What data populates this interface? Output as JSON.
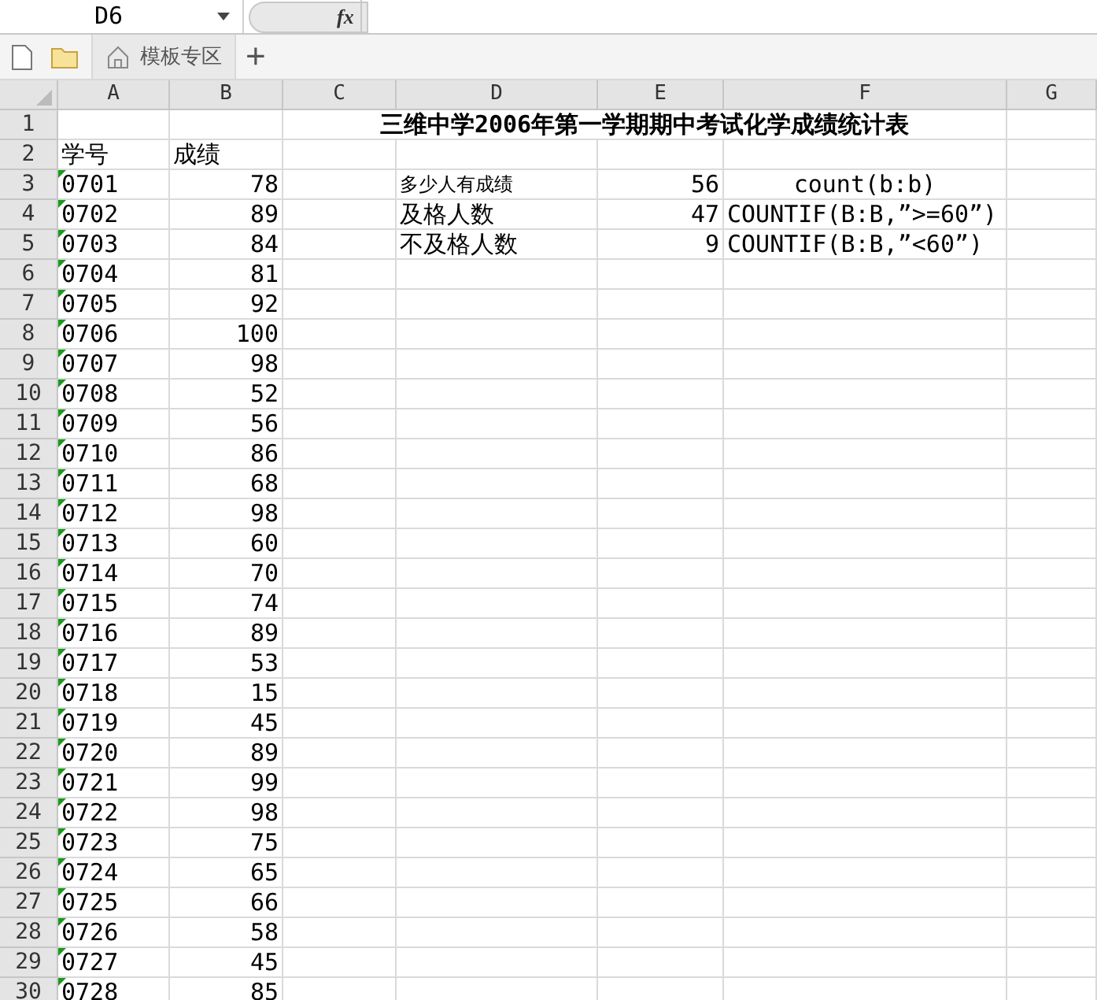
{
  "name_box": "D6",
  "formula_button": "fx",
  "new_tab": "+",
  "tabs": [
    {
      "label": "模板专区"
    }
  ],
  "columns": [
    "A",
    "B",
    "C",
    "D",
    "E",
    "F",
    "G"
  ],
  "rows": [
    {
      "number": "1",
      "title": "三维中学2006年第一学期期中考试化学成绩统计表"
    },
    {
      "number": "2",
      "a": "学号",
      "b": {
        "text": "成绩",
        "kind": "label"
      }
    },
    {
      "number": "3",
      "a": "0701",
      "flagged": true,
      "b": "78",
      "d": {
        "text": "多少人有成绩",
        "kind": "small"
      },
      "e": "56",
      "f": {
        "text": "count(b:b)",
        "kind": "centered"
      }
    },
    {
      "number": "4",
      "a": "0702",
      "flagged": true,
      "b": "89",
      "d": "及格人数",
      "e": "47",
      "f": "COUNTIF(B:B,”>=60”)"
    },
    {
      "number": "5",
      "a": "0703",
      "flagged": true,
      "b": "84",
      "d": "不及格人数",
      "e": "9",
      "f": "COUNTIF(B:B,”<60”)"
    },
    {
      "number": "6",
      "a": "0704",
      "flagged": true,
      "b": "81"
    },
    {
      "number": "7",
      "a": "0705",
      "flagged": true,
      "b": "92"
    },
    {
      "number": "8",
      "a": "0706",
      "flagged": true,
      "b": "100"
    },
    {
      "number": "9",
      "a": "0707",
      "flagged": true,
      "b": "98"
    },
    {
      "number": "10",
      "a": "0708",
      "flagged": true,
      "b": "52"
    },
    {
      "number": "11",
      "a": "0709",
      "flagged": true,
      "b": "56"
    },
    {
      "number": "12",
      "a": "0710",
      "flagged": true,
      "b": "86"
    },
    {
      "number": "13",
      "a": "0711",
      "flagged": true,
      "b": "68"
    },
    {
      "number": "14",
      "a": "0712",
      "flagged": true,
      "b": "98"
    },
    {
      "number": "15",
      "a": "0713",
      "flagged": true,
      "b": "60"
    },
    {
      "number": "16",
      "a": "0714",
      "flagged": true,
      "b": "70"
    },
    {
      "number": "17",
      "a": "0715",
      "flagged": true,
      "b": "74"
    },
    {
      "number": "18",
      "a": "0716",
      "flagged": true,
      "b": "89"
    },
    {
      "number": "19",
      "a": "0717",
      "flagged": true,
      "b": "53"
    },
    {
      "number": "20",
      "a": "0718",
      "flagged": true,
      "b": "15"
    },
    {
      "number": "21",
      "a": "0719",
      "flagged": true,
      "b": "45"
    },
    {
      "number": "22",
      "a": "0720",
      "flagged": true,
      "b": "89"
    },
    {
      "number": "23",
      "a": "0721",
      "flagged": true,
      "b": "99"
    },
    {
      "number": "24",
      "a": "0722",
      "flagged": true,
      "b": "98"
    },
    {
      "number": "25",
      "a": "0723",
      "flagged": true,
      "b": "75"
    },
    {
      "number": "26",
      "a": "0724",
      "flagged": true,
      "b": "65"
    },
    {
      "number": "27",
      "a": "0725",
      "flagged": true,
      "b": "66"
    },
    {
      "number": "28",
      "a": "0726",
      "flagged": true,
      "b": "58"
    },
    {
      "number": "29",
      "a": "0727",
      "flagged": true,
      "b": "45"
    },
    {
      "number": "30",
      "a": "0728",
      "flagged": true,
      "b": "85"
    }
  ]
}
